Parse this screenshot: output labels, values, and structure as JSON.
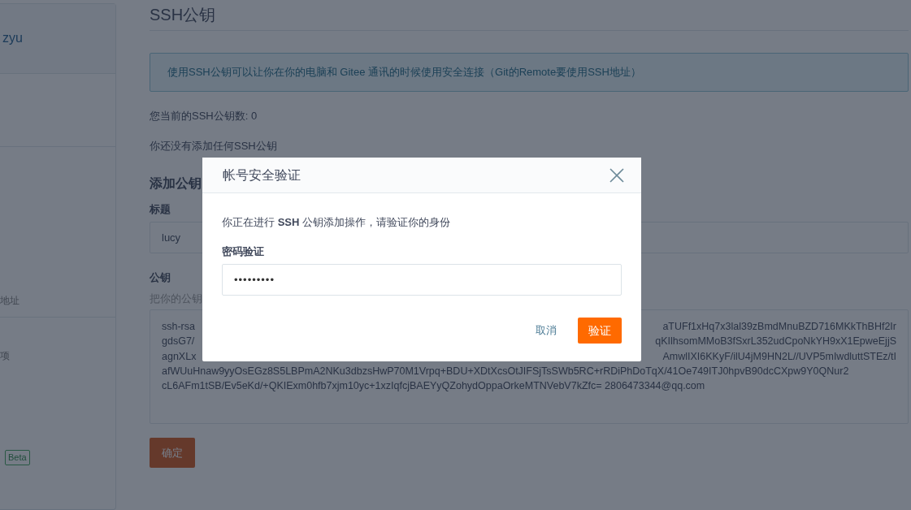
{
  "sidebar": {
    "user": "zyu",
    "items": [
      {
        "label": "地址",
        "kind": "text"
      },
      {
        "label": "项",
        "kind": "text"
      },
      {
        "label": "Beta",
        "kind": "badge"
      }
    ]
  },
  "page": {
    "title": "SSH公钥",
    "notice": "使用SSH公钥可以让你在你的电脑和 Gitee 通讯的时候使用安全连接（Git的Remote要使用SSH地址）",
    "count_text": "您当前的SSH公钥数: 0",
    "empty_text": "你还没有添加任何SSH公钥",
    "add_heading": "添加公钥",
    "title_label": "标题",
    "title_value": "lucy",
    "key_label": "公钥",
    "key_hint": "把你的公钥",
    "key_lines": [
      {
        "left": "ssh-rsa",
        "right": "aTUFf1xHq7x3lal39zBmdMnuBZD716MKkThBHf2Ir"
      },
      {
        "left": "gdsG7/",
        "right": "qKIlhsomMMoB3fSxrL352udCpoNkYH9xX1EpweEjjS"
      },
      {
        "left": "agnXLx",
        "right": "AmwlIXI6KKyF/ilU4jM9HN2L//UVP5mIwdluttSTEz/tI"
      },
      {
        "left": "afWUuHnaw9yyOsEGz8S5LBPmA2NKu3dbzsHwP70M1Vrpq+BDU+XDtXcsOtJIFSjTsSWb5RC+rRDiPhDoTqX/41Oe749ITJ0hpvB90dcCXpw9Y0QNur2"
      },
      {
        "left": "cL6AFm1tSB/Ev5eKd/+QKIExm0hfb7xjm10yc+1xzIqfcjBAEYyQZohydOppaOrkeMTNVebV7kZfc= 2806473344@qq.com"
      }
    ],
    "submit": "确定"
  },
  "dialog": {
    "title": "帐号安全验证",
    "message": "你正在进行 **SSH** 公钥添加操作，请验证你的身份",
    "password_label": "密码验证",
    "password_value": "•••••••••",
    "cancel": "取消",
    "confirm": "验证"
  }
}
